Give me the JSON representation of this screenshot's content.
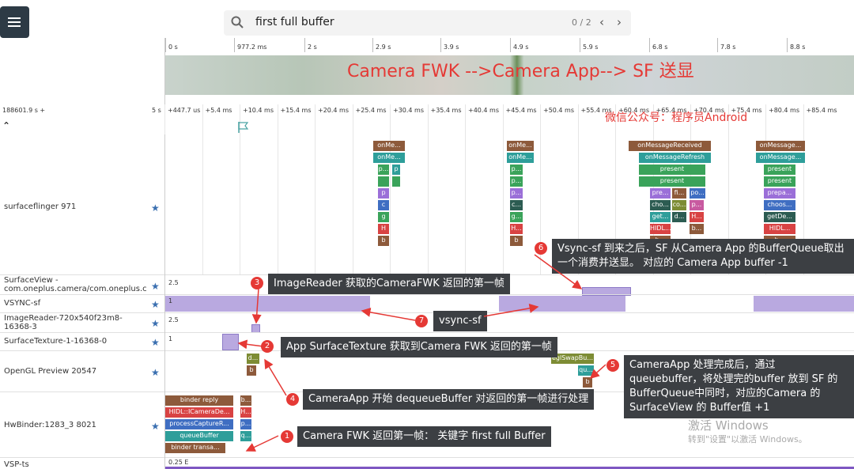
{
  "search": {
    "query": "first full buffer",
    "count": "0 / 2"
  },
  "overview": {
    "ticks": [
      "0 s",
      "977.2 ms",
      "2 s",
      "2.9 s",
      "3.9 s",
      "4.9 s",
      "5.9 s",
      "6.8 s",
      "7.8 s",
      "8.8 s"
    ],
    "title": "Camera FWK -->Camera App--> SF 送显"
  },
  "timeline": {
    "offset": "188601.9 s +",
    "scale": "5 s",
    "ticks": [
      "+447.7 us",
      "+5.4 ms",
      "+10.4 ms",
      "+15.4 ms",
      "+20.4 ms",
      "+25.4 ms",
      "+30.4 ms",
      "+35.4 ms",
      "+40.4 ms",
      "+45.4 ms",
      "+50.4 ms",
      "+55.4 ms",
      "+60.4 ms",
      "+65.4 ms",
      "+70.4 ms",
      "+75.4 ms",
      "+80.4 ms",
      "+85.4 ms"
    ],
    "watermark": "微信公众号：程序员Android"
  },
  "tracks": {
    "surfaceflinger": "surfaceflinger 971",
    "surfaceview": "SurfaceView - com.oneplus.camera/com.oneplus.c",
    "vsync": "VSYNC-sf",
    "imagereader": "ImageReader-720x540f23m8-16368-3",
    "surfacetexture": "SurfaceTexture-1-16368-0",
    "opengl": "OpenGL Preview 20547",
    "hwbinder": "HwBinder:1283_3 8021",
    "vspts": "VSP-ts"
  },
  "counters": {
    "surfaceview": "2.5",
    "vsync": "1",
    "imagereader": "2.5",
    "surfacetexture": "1",
    "vspts": "0.25 E"
  },
  "sf_slices": {
    "a": [
      "onMe...",
      "onMe...",
      "p...",
      "p",
      "p",
      "c",
      "g",
      "H",
      "b"
    ],
    "b": [
      "onMe...",
      "onMe...",
      "p...",
      "p...",
      "p...",
      "c...",
      "g...",
      "H...",
      "b"
    ],
    "c": [
      "onMessageReceived",
      "onMessageRefresh",
      "present",
      "present",
      "pre...",
      "fi...",
      "po...",
      "cho...",
      "co...",
      "p...",
      "get...",
      "d...",
      "H...",
      "HIDL...",
      "b...",
      "b...",
      "binder"
    ],
    "d": [
      "onMessage...",
      "onMessage...",
      "present",
      "present",
      "prepa...",
      "choos...",
      "getDe...",
      "HIDL...",
      "b..."
    ]
  },
  "opengl_slices": [
    "d...",
    "b",
    "eglSwapBu...",
    "qu...",
    "b"
  ],
  "hw_slices": [
    "binder reply",
    "HIDL::ICameraDe...",
    "processCaptureR...",
    "queueBuffer",
    "binder transa...",
    "b...",
    "H...",
    "p...",
    "q...",
    "b..."
  ],
  "callouts": [
    {
      "n": "1",
      "text": "Camera FWK 返回第一帧： 关键字 first full Buffer"
    },
    {
      "n": "2",
      "text": "App SurfaceTexture 获取到Camera FWK 返回的第一帧"
    },
    {
      "n": "3",
      "text": "ImageReader 获取的CameraFWK 返回的第一帧"
    },
    {
      "n": "4",
      "text": "CameraApp 开始 dequeueBuffer 对返回的第一帧进行处理"
    },
    {
      "n": "5",
      "text": "CameraApp 处理完成后，通过queuebuffer，将处理完的buffer 放到 SF 的BufferQueue中同时，对应的Camera 的SurfaceView 的 Buffer值 +1"
    },
    {
      "n": "6",
      "text": "Vsync-sf 到来之后，SF 从Camera App 的BufferQueue取出一个消费并送显。 对应的 Camera App buffer -1"
    },
    {
      "n": "7",
      "text": "vsync-sf"
    }
  ],
  "activation": {
    "line1": "激活 Windows",
    "line2": "转到\"设置\"以激活 Windows。"
  }
}
